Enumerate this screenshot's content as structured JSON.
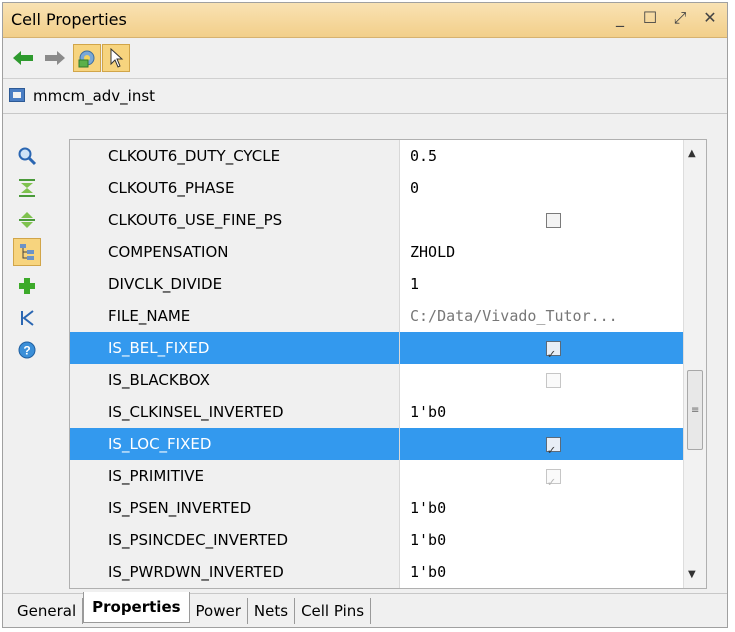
{
  "window": {
    "title": "Cell Properties",
    "controls": [
      "minimize-icon",
      "maximize-icon",
      "float-icon",
      "close-icon"
    ]
  },
  "toolbar": {
    "buttons": [
      "back-arrow-icon",
      "forward-arrow-icon",
      "gear-icon",
      "select-pointer-icon"
    ]
  },
  "cell": {
    "name": "mmcm_adv_inst"
  },
  "sidebar": {
    "buttons": [
      "search-icon",
      "collapse-all-icon",
      "expand-all-icon",
      "hierarchy-icon",
      "add-icon",
      "first-icon",
      "help-icon"
    ]
  },
  "properties": [
    {
      "name": "CLKOUT6_DUTY_CYCLE",
      "value": "0.5",
      "type": "text",
      "selected": false
    },
    {
      "name": "CLKOUT6_PHASE",
      "value": "0",
      "type": "text",
      "selected": false
    },
    {
      "name": "CLKOUT6_USE_FINE_PS",
      "value": "",
      "type": "check",
      "checked": false,
      "disabled": false,
      "selected": false
    },
    {
      "name": "COMPENSATION",
      "value": "ZHOLD",
      "type": "text",
      "selected": false
    },
    {
      "name": "DIVCLK_DIVIDE",
      "value": "1",
      "type": "text",
      "selected": false
    },
    {
      "name": "FILE_NAME",
      "value": "C:/Data/Vivado_Tutor...",
      "type": "text",
      "gray": true,
      "selected": false
    },
    {
      "name": "IS_BEL_FIXED",
      "value": "",
      "type": "check",
      "checked": true,
      "disabled": false,
      "selected": true
    },
    {
      "name": "IS_BLACKBOX",
      "value": "",
      "type": "check",
      "checked": false,
      "disabled": true,
      "selected": false
    },
    {
      "name": "IS_CLKINSEL_INVERTED",
      "value": "1'b0",
      "type": "text",
      "selected": false
    },
    {
      "name": "IS_LOC_FIXED",
      "value": "",
      "type": "check",
      "checked": true,
      "disabled": false,
      "selected": true
    },
    {
      "name": "IS_PRIMITIVE",
      "value": "",
      "type": "check",
      "checked": true,
      "disabled": true,
      "selected": false
    },
    {
      "name": "IS_PSEN_INVERTED",
      "value": "1'b0",
      "type": "text",
      "selected": false
    },
    {
      "name": "IS_PSINCDEC_INVERTED",
      "value": "1'b0",
      "type": "text",
      "selected": false
    },
    {
      "name": "IS_PWRDWN_INVERTED",
      "value": "1'b0",
      "type": "text",
      "selected": false
    }
  ],
  "tabs": [
    {
      "label": "General",
      "active": false
    },
    {
      "label": "Properties",
      "active": true
    },
    {
      "label": "Power",
      "active": false
    },
    {
      "label": "Nets",
      "active": false
    },
    {
      "label": "Cell Pins",
      "active": false
    }
  ],
  "colors": {
    "selection": "#3399ee",
    "title_bar": "#f2cf8a",
    "highlight_button": "#f7d47e"
  }
}
